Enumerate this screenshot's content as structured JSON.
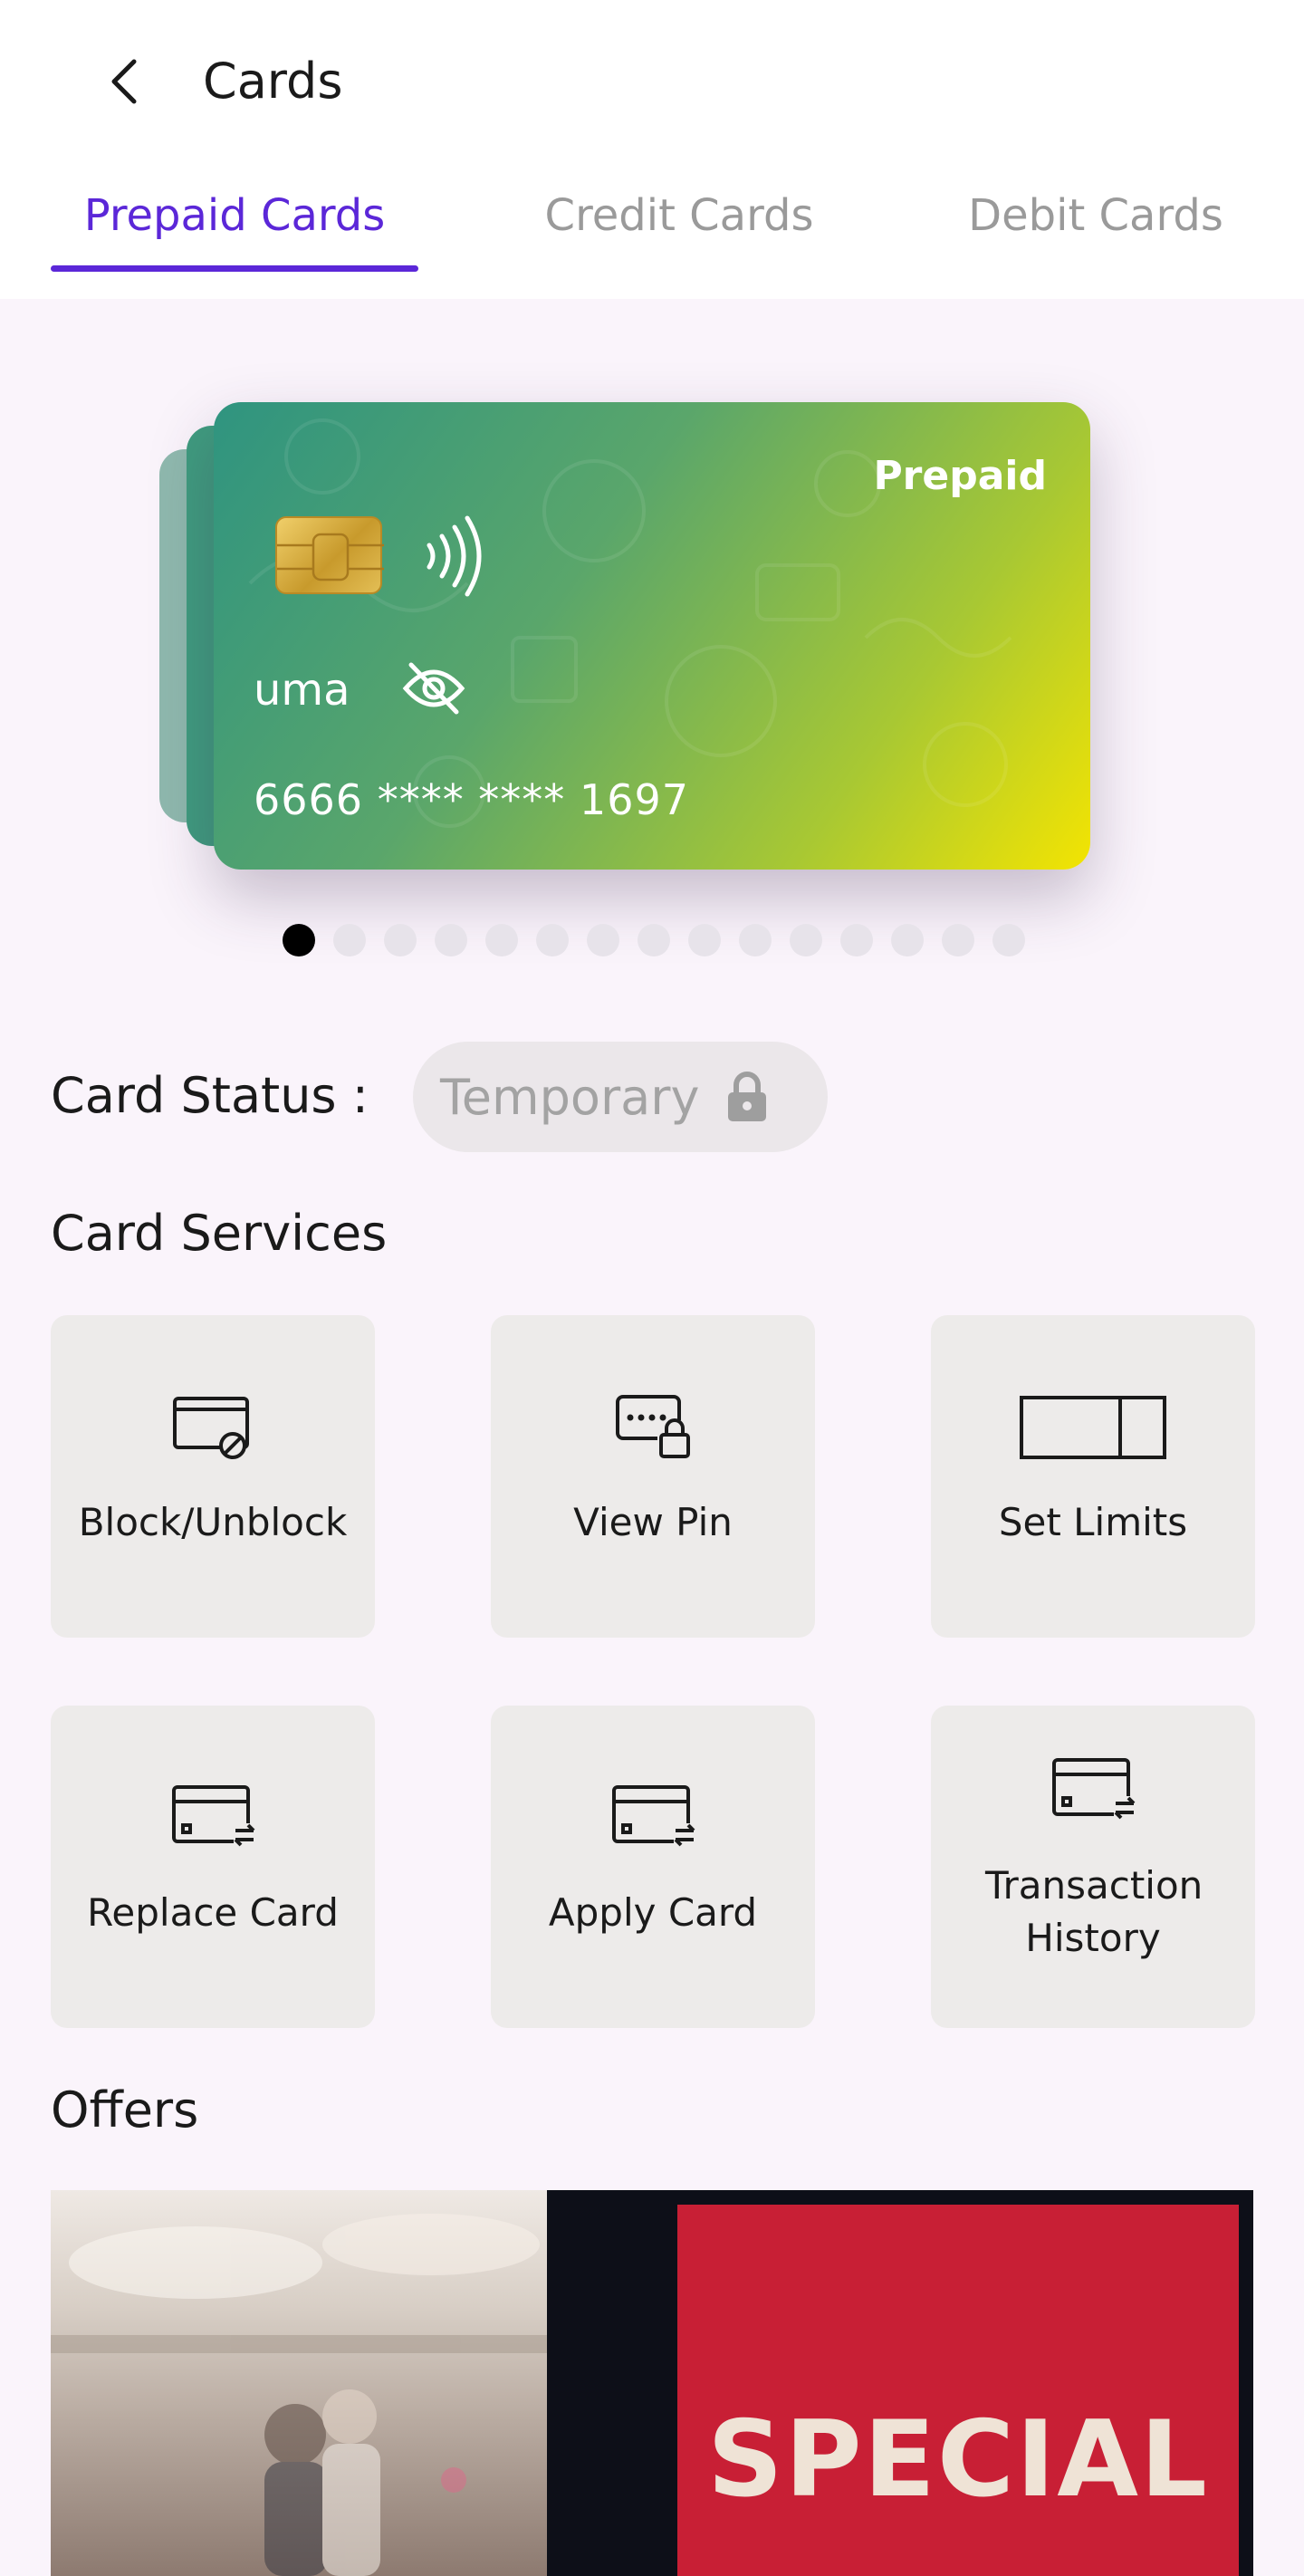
{
  "header": {
    "title": "Cards"
  },
  "tabs": [
    {
      "label": "Prepaid Cards",
      "active": true
    },
    {
      "label": "Credit Cards",
      "active": false
    },
    {
      "label": "Debit Cards",
      "active": false
    }
  ],
  "card": {
    "type": "Prepaid",
    "holder": "uma",
    "number": "6666 **** **** 1697",
    "gradient_start": "#2f9480",
    "gradient_end": "#f3e402"
  },
  "carousel": {
    "total": 15,
    "active_index": 0
  },
  "status": {
    "label": "Card Status :",
    "value": "Temporary",
    "icon": "lock-icon"
  },
  "services": {
    "title": "Card Services",
    "items": [
      {
        "label": "Block/Unblock",
        "icon": "card-block-icon"
      },
      {
        "label": "View Pin",
        "icon": "pin-lock-icon"
      },
      {
        "label": "Set Limits",
        "icon": "limits-icon"
      },
      {
        "label": "Replace Card",
        "icon": "card-exchange-icon"
      },
      {
        "label": "Apply Card",
        "icon": "card-exchange-icon"
      },
      {
        "label": "Transaction History",
        "icon": "card-exchange-icon"
      }
    ]
  },
  "offers": {
    "title": "Offers",
    "banner_text": "SPECIAL"
  },
  "colors": {
    "accent": "#5b27d8",
    "tab_inactive": "#9a9a9a",
    "background": "#faf4fb",
    "tile": "#edebea"
  }
}
